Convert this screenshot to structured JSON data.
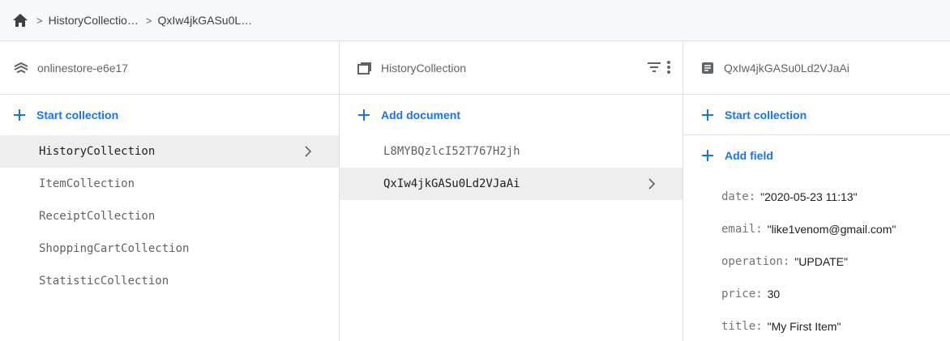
{
  "breadcrumb": {
    "crumbs": [
      "HistoryCollectio…",
      "QxIw4jkGASu0L…"
    ]
  },
  "panel_root": {
    "title": "onlinestore-e6e17",
    "action_label": "Start collection",
    "items": [
      {
        "label": "HistoryCollection",
        "selected": true
      },
      {
        "label": "ItemCollection"
      },
      {
        "label": "ReceiptCollection"
      },
      {
        "label": "ShoppingCartCollection"
      },
      {
        "label": "StatisticCollection"
      }
    ]
  },
  "panel_collection": {
    "title": "HistoryCollection",
    "action_label": "Add document",
    "items": [
      {
        "label": "L8MYBQzlcI52T767H2jh"
      },
      {
        "label": "QxIw4jkGASu0Ld2VJaAi",
        "selected": true
      }
    ]
  },
  "panel_document": {
    "title": "QxIw4jkGASu0Ld2VJaAi",
    "start_collection_label": "Start collection",
    "add_field_label": "Add field",
    "fields": [
      {
        "name": "date",
        "value": "\"2020-05-23 11:13\""
      },
      {
        "name": "email",
        "value": "\"like1venom@gmail.com\""
      },
      {
        "name": "operation",
        "value": "\"UPDATE\""
      },
      {
        "name": "price",
        "value": "30"
      },
      {
        "name": "title",
        "value": "\"My First Item\""
      }
    ]
  },
  "colors": {
    "accent": "#1a73e8",
    "selected_bg": "#eeeeee",
    "breadcrumb_bg": "#f8f9fa"
  },
  "icons": {
    "home": "home-icon",
    "project": "firestore-icon",
    "collection": "collection-icon",
    "document": "document-icon",
    "filter": "filter-icon",
    "more": "more-vert-icon",
    "add": "plus-icon",
    "chevron": "chevron-right-icon"
  }
}
